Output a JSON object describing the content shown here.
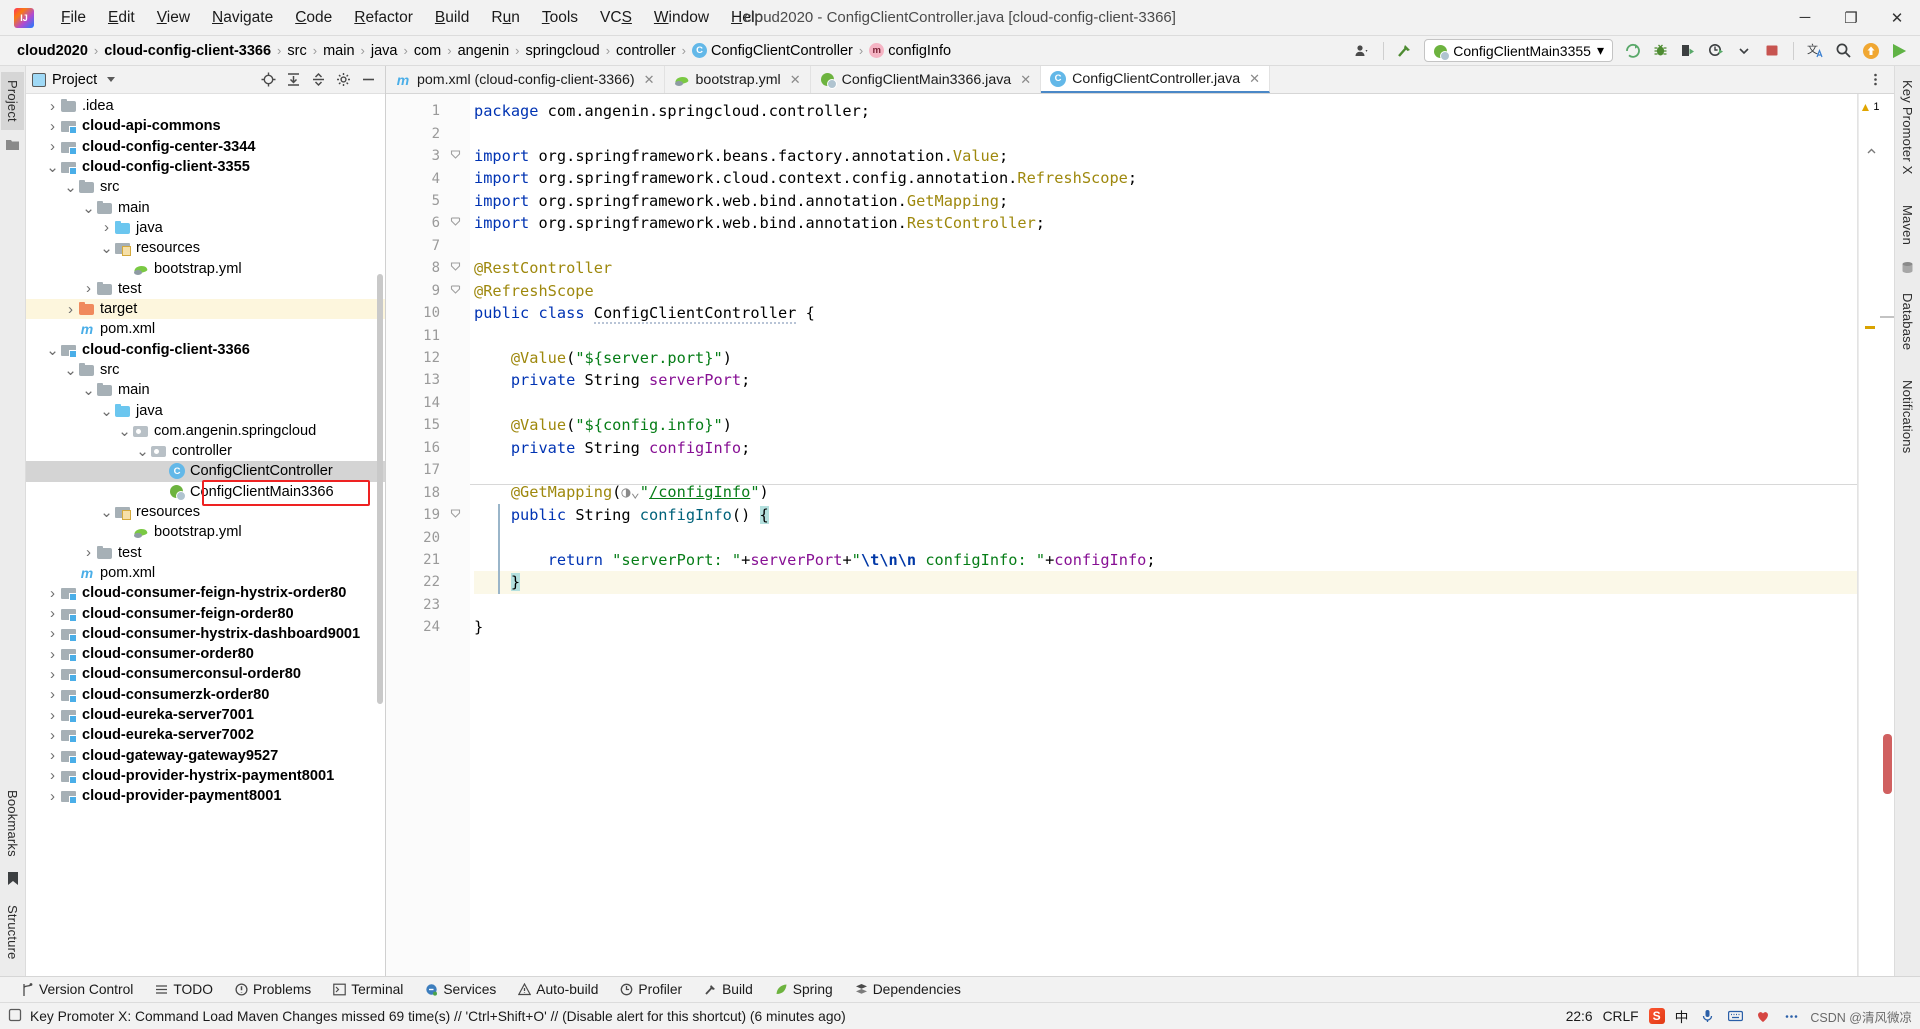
{
  "titlebar": {
    "logo_name": "intellij-idea-logo",
    "menus": [
      "File",
      "Edit",
      "View",
      "Navigate",
      "Code",
      "Refactor",
      "Build",
      "Run",
      "Tools",
      "VCS",
      "Window",
      "Help"
    ],
    "window_title": "cloud2020 - ConfigClientController.java [cloud-config-client-3366]",
    "minimize": "─",
    "maximize": "❐",
    "close": "✕"
  },
  "navbar": {
    "crumbs": [
      {
        "label": "cloud2020",
        "bold": true,
        "icon": ""
      },
      {
        "label": "cloud-config-client-3366",
        "bold": true,
        "icon": ""
      },
      {
        "label": "src",
        "bold": false,
        "icon": ""
      },
      {
        "label": "main",
        "bold": false,
        "icon": ""
      },
      {
        "label": "java",
        "bold": false,
        "icon": ""
      },
      {
        "label": "com",
        "bold": false,
        "icon": ""
      },
      {
        "label": "angenin",
        "bold": false,
        "icon": ""
      },
      {
        "label": "springcloud",
        "bold": false,
        "icon": ""
      },
      {
        "label": "controller",
        "bold": false,
        "icon": ""
      },
      {
        "label": "ConfigClientController",
        "bold": false,
        "icon": "class"
      },
      {
        "label": "configInfo",
        "bold": false,
        "icon": "method"
      }
    ],
    "separator": "›",
    "class_badge": "C",
    "method_badge": "m",
    "run_config": "ConfigClientMain3355",
    "run_config_caret": "▾",
    "icons": [
      "profile-icon",
      "hammer-build-icon",
      "run-icon",
      "debug-icon",
      "run-coverage-icon",
      "profiler-run-icon",
      "stop-icon",
      "translate-icon",
      "search-everywhere-icon",
      "update-icon",
      "play-green-icon"
    ]
  },
  "left_strip": {
    "tabs": [
      "Project",
      "Bookmarks",
      "Structure"
    ],
    "active": "Project"
  },
  "right_strip": {
    "tabs": [
      "Key Promoter X",
      "Maven",
      "Database",
      "Notifications"
    ]
  },
  "project_panel": {
    "title": "Project",
    "caret": "▾",
    "toolbar_icons": [
      "select-opened-file-icon",
      "expand-all-icon",
      "collapse-all-icon",
      "settings-gear-icon",
      "hide-panel-icon"
    ],
    "tree": [
      {
        "depth": 1,
        "label": ".idea",
        "arrow": "›",
        "icon": "folder",
        "bold": false,
        "state": "partial"
      },
      {
        "depth": 1,
        "label": "cloud-api-commons",
        "arrow": "›",
        "icon": "module",
        "bold": true,
        "state": ""
      },
      {
        "depth": 1,
        "label": "cloud-config-center-3344",
        "arrow": "›",
        "icon": "module",
        "bold": true,
        "state": ""
      },
      {
        "depth": 1,
        "label": "cloud-config-client-3355",
        "arrow": "⌄",
        "icon": "module",
        "bold": true,
        "state": ""
      },
      {
        "depth": 2,
        "label": "src",
        "arrow": "⌄",
        "icon": "folder",
        "bold": false,
        "state": ""
      },
      {
        "depth": 3,
        "label": "main",
        "arrow": "⌄",
        "icon": "folder",
        "bold": false,
        "state": ""
      },
      {
        "depth": 4,
        "label": "java",
        "arrow": "›",
        "icon": "folder-blue",
        "bold": false,
        "state": ""
      },
      {
        "depth": 4,
        "label": "resources",
        "arrow": "⌄",
        "icon": "resources",
        "bold": false,
        "state": ""
      },
      {
        "depth": 5,
        "label": "bootstrap.yml",
        "arrow": "",
        "icon": "yml",
        "bold": false,
        "state": ""
      },
      {
        "depth": 3,
        "label": "test",
        "arrow": "›",
        "icon": "folder",
        "bold": false,
        "state": ""
      },
      {
        "depth": 2,
        "label": "target",
        "arrow": "›",
        "icon": "folder-orange",
        "bold": false,
        "state": "warn"
      },
      {
        "depth": 2,
        "label": "pom.xml",
        "arrow": "",
        "icon": "maven",
        "bold": false,
        "state": ""
      },
      {
        "depth": 1,
        "label": "cloud-config-client-3366",
        "arrow": "⌄",
        "icon": "module",
        "bold": true,
        "state": ""
      },
      {
        "depth": 2,
        "label": "src",
        "arrow": "⌄",
        "icon": "folder",
        "bold": false,
        "state": ""
      },
      {
        "depth": 3,
        "label": "main",
        "arrow": "⌄",
        "icon": "folder",
        "bold": false,
        "state": ""
      },
      {
        "depth": 4,
        "label": "java",
        "arrow": "⌄",
        "icon": "folder-blue",
        "bold": false,
        "state": ""
      },
      {
        "depth": 5,
        "label": "com.angenin.springcloud",
        "arrow": "⌄",
        "icon": "package",
        "bold": false,
        "state": ""
      },
      {
        "depth": 6,
        "label": "controller",
        "arrow": "⌄",
        "icon": "package",
        "bold": false,
        "state": ""
      },
      {
        "depth": 7,
        "label": "ConfigClientController",
        "arrow": "",
        "icon": "class",
        "bold": false,
        "state": "selected"
      },
      {
        "depth": 7,
        "label": "ConfigClientMain3366",
        "arrow": "",
        "icon": "spring",
        "bold": false,
        "state": ""
      },
      {
        "depth": 4,
        "label": "resources",
        "arrow": "⌄",
        "icon": "resources",
        "bold": false,
        "state": ""
      },
      {
        "depth": 5,
        "label": "bootstrap.yml",
        "arrow": "",
        "icon": "yml",
        "bold": false,
        "state": ""
      },
      {
        "depth": 3,
        "label": "test",
        "arrow": "›",
        "icon": "folder",
        "bold": false,
        "state": ""
      },
      {
        "depth": 2,
        "label": "pom.xml",
        "arrow": "",
        "icon": "maven",
        "bold": false,
        "state": ""
      },
      {
        "depth": 1,
        "label": "cloud-consumer-feign-hystrix-order80",
        "arrow": "›",
        "icon": "module",
        "bold": true,
        "state": ""
      },
      {
        "depth": 1,
        "label": "cloud-consumer-feign-order80",
        "arrow": "›",
        "icon": "module",
        "bold": true,
        "state": ""
      },
      {
        "depth": 1,
        "label": "cloud-consumer-hystrix-dashboard9001",
        "arrow": "›",
        "icon": "module",
        "bold": true,
        "state": ""
      },
      {
        "depth": 1,
        "label": "cloud-consumer-order80",
        "arrow": "›",
        "icon": "module",
        "bold": true,
        "state": ""
      },
      {
        "depth": 1,
        "label": "cloud-consumerconsul-order80",
        "arrow": "›",
        "icon": "module",
        "bold": true,
        "state": ""
      },
      {
        "depth": 1,
        "label": "cloud-consumerzk-order80",
        "arrow": "›",
        "icon": "module",
        "bold": true,
        "state": ""
      },
      {
        "depth": 1,
        "label": "cloud-eureka-server7001",
        "arrow": "›",
        "icon": "module",
        "bold": true,
        "state": ""
      },
      {
        "depth": 1,
        "label": "cloud-eureka-server7002",
        "arrow": "›",
        "icon": "module",
        "bold": true,
        "state": ""
      },
      {
        "depth": 1,
        "label": "cloud-gateway-gateway9527",
        "arrow": "›",
        "icon": "module",
        "bold": true,
        "state": ""
      },
      {
        "depth": 1,
        "label": "cloud-provider-hystrix-payment8001",
        "arrow": "›",
        "icon": "module",
        "bold": true,
        "state": ""
      },
      {
        "depth": 1,
        "label": "cloud-provider-payment8001",
        "arrow": "›",
        "icon": "module",
        "bold": true,
        "state": ""
      }
    ]
  },
  "editor": {
    "tabs": [
      {
        "label": "pom.xml (cloud-config-client-3366)",
        "icon": "maven",
        "active": false,
        "close": "✕"
      },
      {
        "label": "bootstrap.yml",
        "icon": "yml",
        "active": false,
        "close": "✕"
      },
      {
        "label": "ConfigClientMain3366.java",
        "icon": "spring",
        "active": false,
        "close": "✕"
      },
      {
        "label": "ConfigClientController.java",
        "icon": "class",
        "active": true,
        "close": "✕"
      }
    ],
    "more_tabs_icon": "more-options-icon",
    "warning_count": "1",
    "warning_icon": "warning-triangle-icon",
    "lines": [
      {
        "n": 1,
        "text": "package com.angenin.springcloud.controller;"
      },
      {
        "n": 2,
        "text": ""
      },
      {
        "n": 3,
        "text": "import org.springframework.beans.factory.annotation.Value;"
      },
      {
        "n": 4,
        "text": "import org.springframework.cloud.context.config.annotation.RefreshScope;"
      },
      {
        "n": 5,
        "text": "import org.springframework.web.bind.annotation.GetMapping;"
      },
      {
        "n": 6,
        "text": "import org.springframework.web.bind.annotation.RestController;"
      },
      {
        "n": 7,
        "text": ""
      },
      {
        "n": 8,
        "text": "@RestController"
      },
      {
        "n": 9,
        "text": "@RefreshScope"
      },
      {
        "n": 10,
        "text": "public class ConfigClientController {"
      },
      {
        "n": 11,
        "text": ""
      },
      {
        "n": 12,
        "text": "    @Value(\"${server.port}\")"
      },
      {
        "n": 13,
        "text": "    private String serverPort;"
      },
      {
        "n": 14,
        "text": ""
      },
      {
        "n": 15,
        "text": "    @Value(\"${config.info}\")"
      },
      {
        "n": 16,
        "text": "    private String configInfo;"
      },
      {
        "n": 17,
        "text": ""
      },
      {
        "n": 18,
        "text": "    @GetMapping(\"/configInfo\")"
      },
      {
        "n": 19,
        "text": "    public String configInfo() {"
      },
      {
        "n": 20,
        "text": ""
      },
      {
        "n": 21,
        "text": "        return \"serverPort: \"+serverPort+\"\\t\\n\\n configInfo: \"+configInfo;"
      },
      {
        "n": 22,
        "text": "    }"
      },
      {
        "n": 23,
        "text": ""
      },
      {
        "n": 24,
        "text": "}"
      }
    ]
  },
  "bottom_toolwindows": [
    {
      "label": "Version Control",
      "icon": "branch-icon"
    },
    {
      "label": "TODO",
      "icon": "list-icon"
    },
    {
      "label": "Problems",
      "icon": "problems-icon"
    },
    {
      "label": "Terminal",
      "icon": "terminal-icon"
    },
    {
      "label": "Services",
      "icon": "services-icon"
    },
    {
      "label": "Auto-build",
      "icon": "auto-build-icon"
    },
    {
      "label": "Profiler",
      "icon": "profiler-icon"
    },
    {
      "label": "Build",
      "icon": "build-hammer-icon"
    },
    {
      "label": "Spring",
      "icon": "spring-leaf-icon"
    },
    {
      "label": "Dependencies",
      "icon": "dependencies-icon"
    }
  ],
  "statusbar": {
    "message_icon": "event-log-icon",
    "message": "Key Promoter X: Command Load Maven Changes missed 69 time(s) // 'Ctrl+Shift+O' // (Disable alert for this shortcut) (6 minutes ago)",
    "caret_position": "22:6",
    "line_separator": "CRLF",
    "watermark": "CSDN @清风微凉",
    "tray_icons": [
      "csdn-icon",
      "ime-cn-icon",
      "mic-icon",
      "keyboard-icon",
      "tray-heart-icon",
      "tray-more-icon"
    ],
    "ime_label": "中"
  },
  "colors": {
    "accent_blue": "#4a88c7",
    "selection_gray": "#d4d4d4",
    "warn_yellow": "#fdf6dd",
    "annotation_red": "#ee2222",
    "keyword_blue": "#0033b3",
    "string_green": "#067d17",
    "annotation_gold": "#9e880d",
    "field_purple": "#871094"
  }
}
